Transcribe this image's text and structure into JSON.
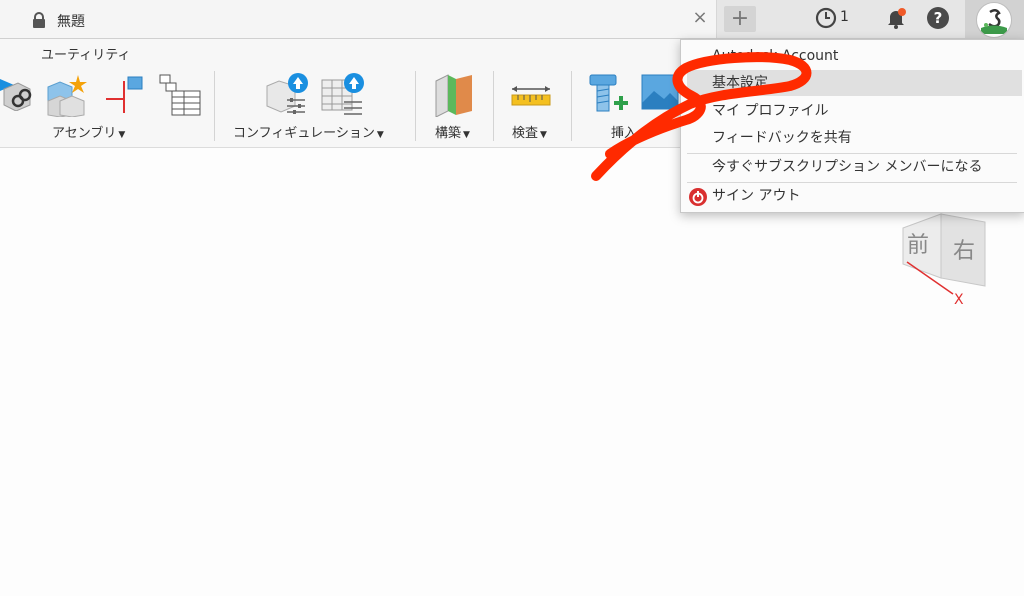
{
  "tab": {
    "title": "無題",
    "close_label": "×",
    "new_tab_label": "+"
  },
  "topbar": {
    "job_count": "1",
    "help_label": "?",
    "notification_dot_color": "#f05a28"
  },
  "toolbar": {
    "utility_label": "ユーティリティ",
    "groups": [
      {
        "label": "アセンブリ",
        "caret": "▼"
      },
      {
        "label": "コンフィギュレーション",
        "caret": "▼"
      },
      {
        "label": "構築",
        "caret": "▼"
      },
      {
        "label": "検査",
        "caret": "▼"
      },
      {
        "label": "挿入"
      }
    ]
  },
  "menu": {
    "items": [
      {
        "label": "Autodesk Account"
      },
      {
        "label": "基本設定",
        "selected": true
      },
      {
        "label": "マイ プロファイル"
      },
      {
        "label": "フィードバックを共有"
      },
      {
        "label": "今すぐサブスクリプション メンバーになる"
      },
      {
        "label": "サイン アウト"
      }
    ]
  },
  "viewcube": {
    "face_front": "前",
    "face_right": "右",
    "axis_x": "X"
  },
  "colors": {
    "annotation": "#ff2a00",
    "accent_blue": "#1a8fe0",
    "axis_red": "#e03030"
  }
}
